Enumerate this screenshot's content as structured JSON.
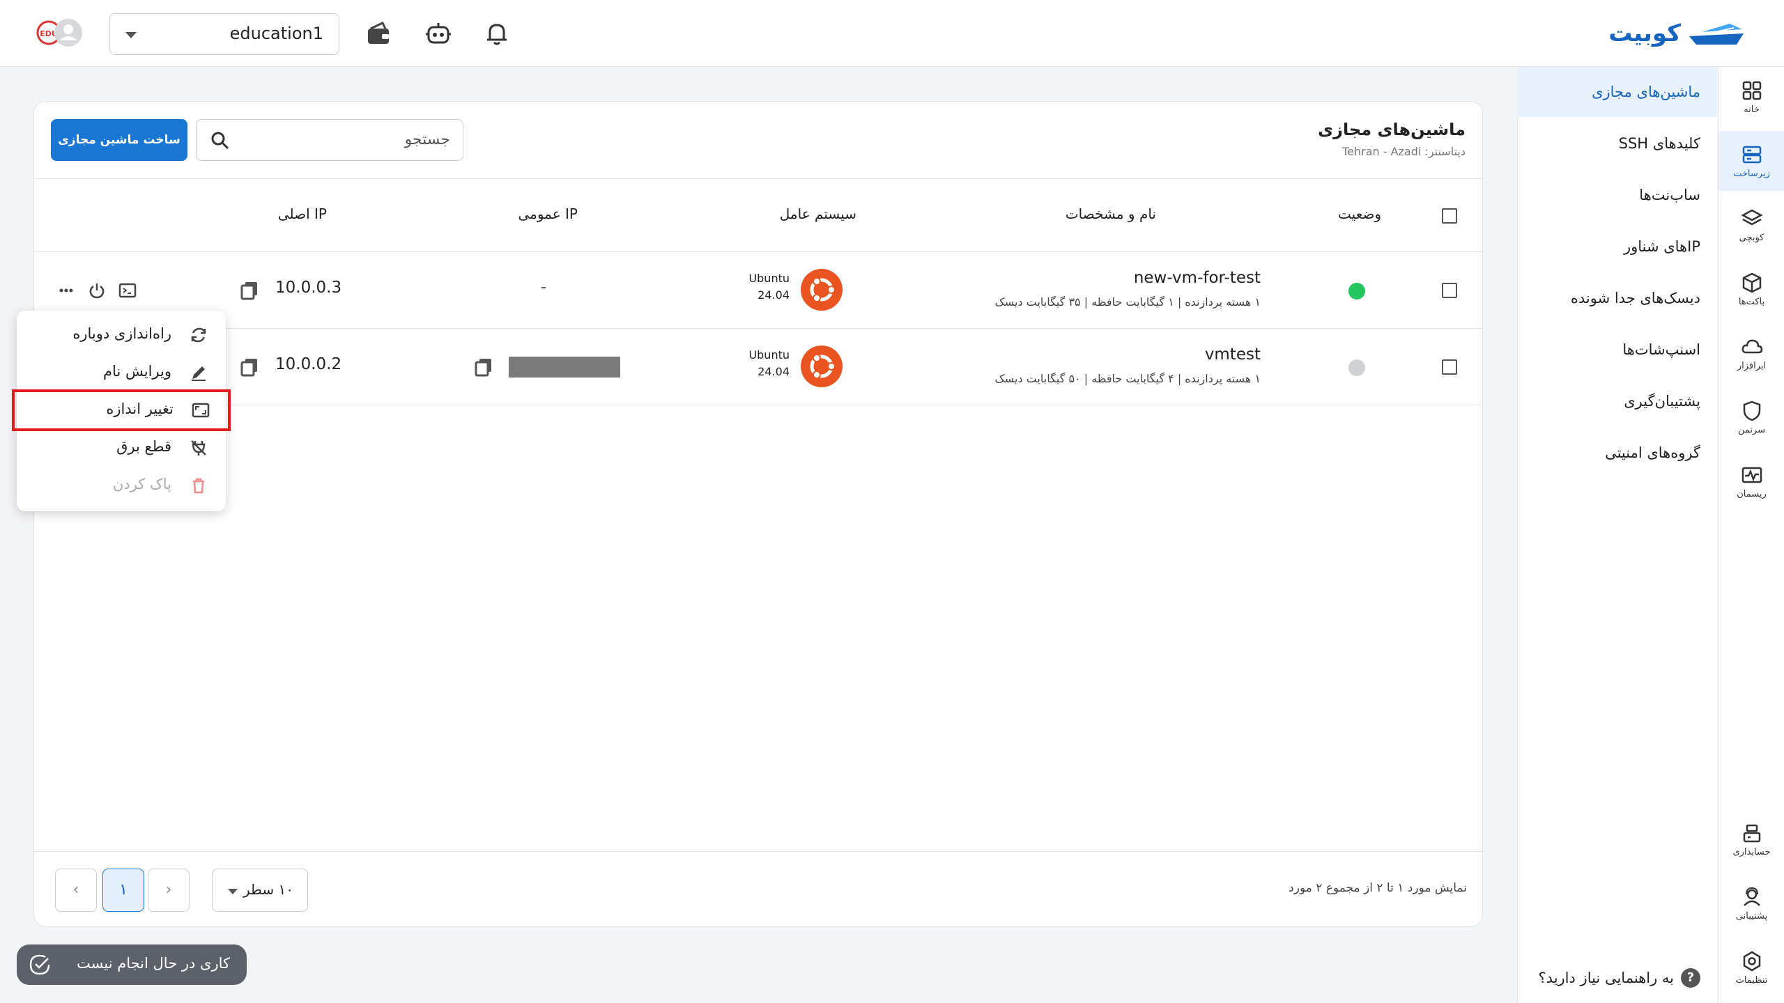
{
  "app": {
    "logo_text": "کوبیت",
    "brand_color": "#1565c0"
  },
  "topbar": {
    "workspace": "education1"
  },
  "rail": [
    {
      "label": "خانه",
      "icon": "grid-icon"
    },
    {
      "label": "زیرساخت",
      "icon": "server-icon",
      "active": true
    },
    {
      "label": "کوبچی",
      "icon": "layers-icon"
    },
    {
      "label": "باکت‌ها",
      "icon": "cube-icon"
    },
    {
      "label": "ابرافزار",
      "icon": "cloud-icon"
    },
    {
      "label": "سرتمن",
      "icon": "shield-icon"
    },
    {
      "label": "ریسمان",
      "icon": "pulse-icon"
    },
    {
      "label": "حسابداری",
      "icon": "cash-register-icon"
    },
    {
      "label": "پشتیبانی",
      "icon": "support-icon"
    },
    {
      "label": "تنظیمات",
      "icon": "settings-icon"
    }
  ],
  "submenu": {
    "items": [
      "ماشین‌های مجازی",
      "کلیدهای SSH",
      "ساب‌نت‌ها",
      "IPهای شناور",
      "دیسک‌های جدا شونده",
      "اسنپ‌شات‌ها",
      "پشتیبان‌گیری",
      "گروه‌های امنیتی"
    ],
    "help": "به راهنمایی نیاز دارید؟"
  },
  "page": {
    "title": "ماشین‌های مجازی",
    "datacenter": "دیتاسنتر: Tehran - Azadi",
    "create_button": "ساخت ماشین مجازی",
    "search_placeholder": "جستجو"
  },
  "table": {
    "headers": {
      "status": "وضعیت",
      "name": "نام و مشخصات",
      "os": "سیستم عامل",
      "public_ip": "IP عمومی",
      "private_ip": "IP اصلی"
    },
    "rows": [
      {
        "name": "new-vm-for-test",
        "spec": "۱ هسته پردازنده | ۱ گیگابایت حافظه | ۳۵ گیگابایت دیسک",
        "status_color": "#22c55e",
        "os": "Ubuntu",
        "os_version": "24.04",
        "public_ip": "-",
        "private_ip": "10.0.0.3"
      },
      {
        "name": "vmtest",
        "spec": "۱ هسته پردازنده | ۴ گیگابایت حافظه | ۵۰ گیگابایت دیسک",
        "status_color": "#cfd1d4",
        "os": "Ubuntu",
        "os_version": "24.04",
        "public_ip": "",
        "private_ip": "10.0.0.2"
      }
    ]
  },
  "pagination": {
    "info": "نمایش مورد ۱ تا ۲ از مجموع ۲ مورد",
    "page_size": "۱۰ سطر",
    "current_page": "۱"
  },
  "context_menu": [
    {
      "label": "راه‌اندازی دوباره",
      "icon": "restart-icon"
    },
    {
      "label": "ویرایش نام",
      "icon": "pencil-icon"
    },
    {
      "label": "تغییر اندازه",
      "icon": "resize-icon",
      "highlighted": true
    },
    {
      "label": "قطع برق",
      "icon": "power-off-icon"
    },
    {
      "label": "پاک کردن",
      "icon": "trash-icon",
      "disabled": true
    }
  ],
  "toast": {
    "text": "کاری در حال انجام نیست"
  }
}
